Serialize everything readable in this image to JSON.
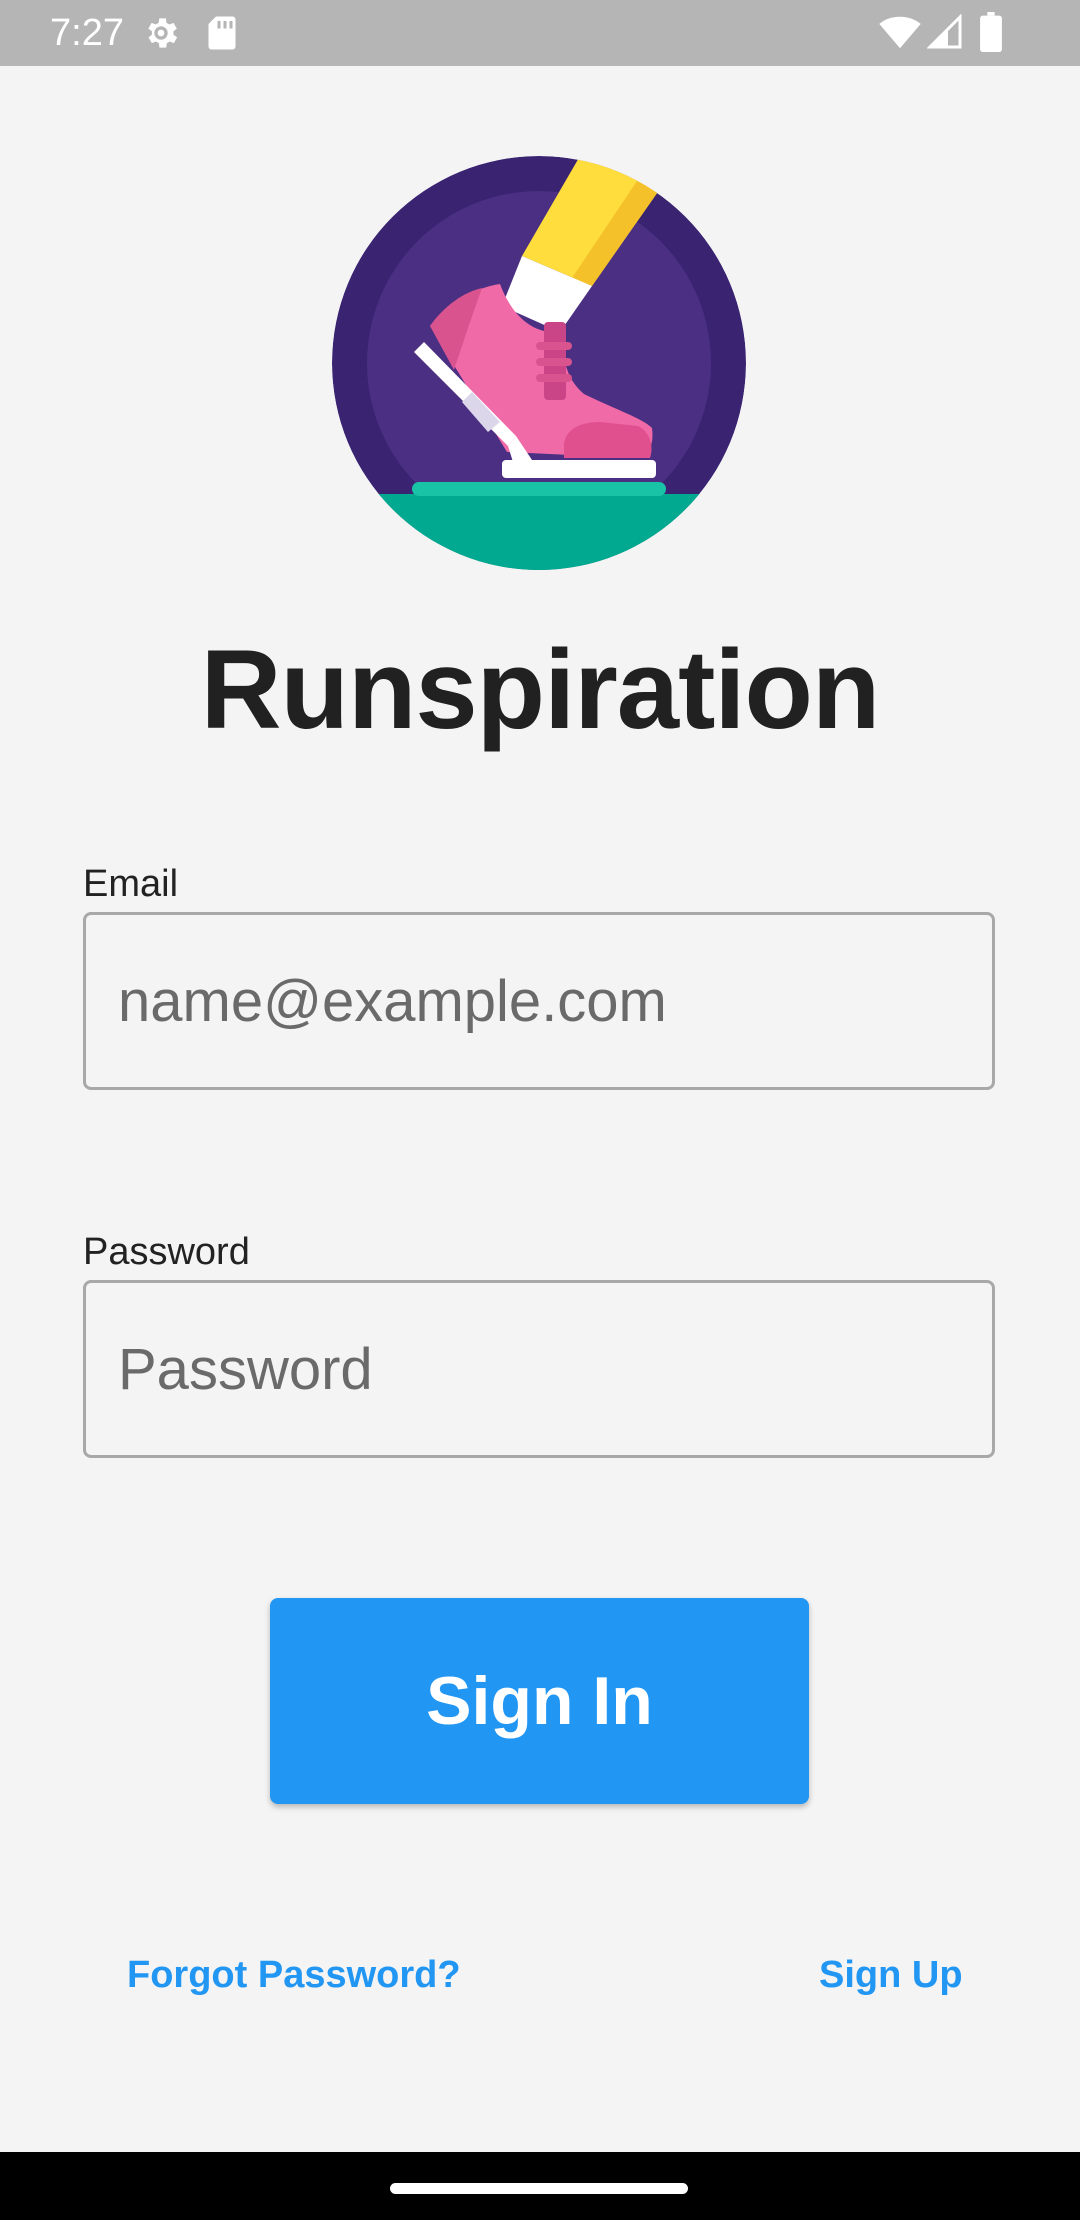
{
  "status_bar": {
    "time": "7:27",
    "icons": [
      "gear-icon",
      "sd-card-icon",
      "wifi-icon",
      "signal-icon",
      "battery-icon"
    ]
  },
  "logo": {
    "icon": "running-shoe-icon",
    "colors": {
      "outer": "#3a2472",
      "inner": "#4a2f82",
      "ground": "#00a98f",
      "shoe": "#f06aa8",
      "sock": "#ffffff",
      "leg": "#ffdd3c"
    }
  },
  "app": {
    "title": "Runspiration"
  },
  "form": {
    "email": {
      "label": "Email",
      "placeholder": "name@example.com",
      "value": ""
    },
    "password": {
      "label": "Password",
      "placeholder": "Password",
      "value": ""
    },
    "submit_label": "Sign In"
  },
  "links": {
    "forgot_password": "Forgot Password?",
    "sign_up": "Sign Up"
  },
  "colors": {
    "accent": "#2196f3",
    "background": "#f4f4f4",
    "title": "#212121"
  }
}
